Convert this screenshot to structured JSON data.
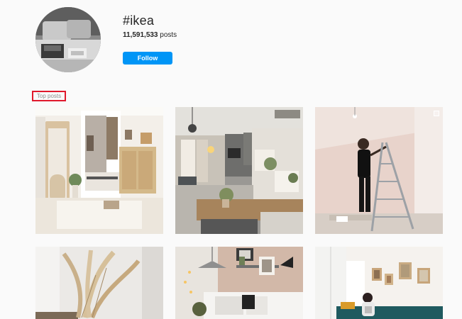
{
  "header": {
    "hashtag": "#ikea",
    "post_count": "11,591,533",
    "post_suffix": "posts",
    "follow_label": "Follow"
  },
  "section": {
    "label": "Top posts"
  },
  "colors": {
    "accent": "#0095f6",
    "highlight_border": "#e0192c"
  },
  "posts": [
    {
      "description": "bright bedroom with arched mirror and rattan cabinet"
    },
    {
      "description": "grey living room with kitchen counter and lamps"
    },
    {
      "description": "person on ladder painting pink wall"
    },
    {
      "description": "pampas grass in vase"
    },
    {
      "description": "living room with pendant lamp and wall shelves"
    },
    {
      "description": "person on teal sofa with framed pictures"
    }
  ]
}
